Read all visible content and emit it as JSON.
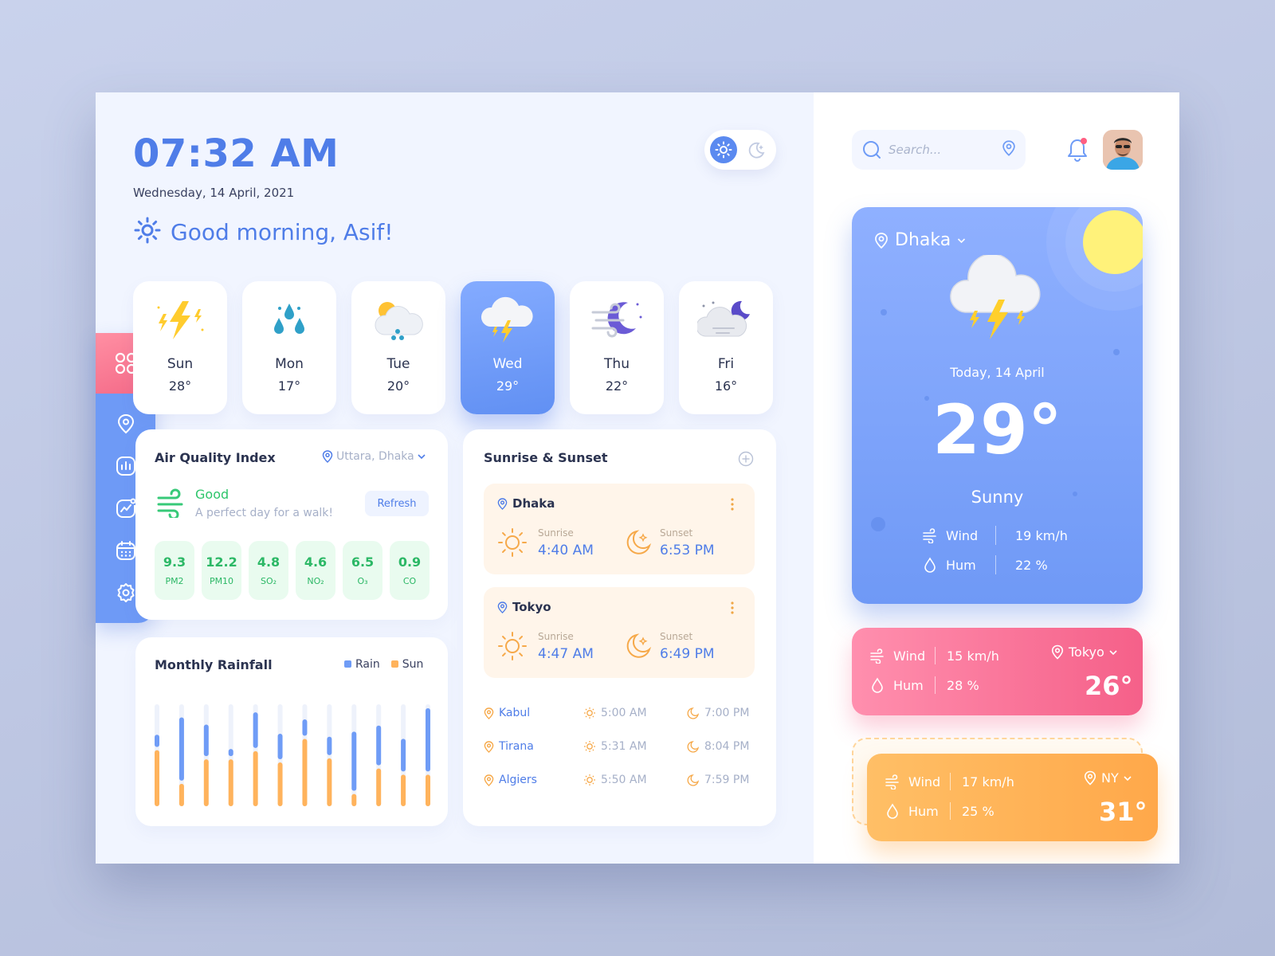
{
  "header": {
    "time": "07:32 AM",
    "date": "Wednesday, 14 April, 2021",
    "greeting": "Good morning, Asif!"
  },
  "theme_toggle": {
    "options": [
      "sun-icon",
      "moon-icon"
    ],
    "active": "sun-icon"
  },
  "sidebar": {
    "items": [
      "grid-icon",
      "location-icon",
      "chart-icon",
      "trend-icon",
      "calendar-icon",
      "settings-icon"
    ],
    "active": "grid-icon"
  },
  "forecast": [
    {
      "day": "Sun",
      "temp": "28°",
      "icon": "thunder-icon"
    },
    {
      "day": "Mon",
      "temp": "17°",
      "icon": "rain-drops-icon"
    },
    {
      "day": "Tue",
      "temp": "20°",
      "icon": "sun-cloud-rain-icon"
    },
    {
      "day": "Wed",
      "temp": "29°",
      "icon": "cloud-thunder-icon",
      "active": true
    },
    {
      "day": "Thu",
      "temp": "22°",
      "icon": "wind-moon-icon"
    },
    {
      "day": "Fri",
      "temp": "16°",
      "icon": "cloud-moon-icon"
    }
  ],
  "air_quality": {
    "title": "Air Quality Index",
    "location": "Uttara, Dhaka",
    "status": "Good",
    "message": "A perfect day for a walk!",
    "refresh_label": "Refresh",
    "metrics": [
      {
        "value": "9.3",
        "label": "PM2"
      },
      {
        "value": "12.2",
        "label": "PM10"
      },
      {
        "value": "4.8",
        "label": "SO₂"
      },
      {
        "value": "4.6",
        "label": "NO₂"
      },
      {
        "value": "6.5",
        "label": "O₃"
      },
      {
        "value": "0.9",
        "label": "CO"
      }
    ]
  },
  "rainfall": {
    "title": "Monthly Rainfall",
    "legend": {
      "rain": "Rain",
      "sun": "Sun"
    },
    "colors": {
      "rain": "#6f9cf6",
      "sun": "#ffb35c",
      "track": "#eef2fb"
    },
    "bars": [
      {
        "rain": 0.12,
        "sun": 0.55
      },
      {
        "rain": 0.62,
        "sun": 0.22
      },
      {
        "rain": 0.31,
        "sun": 0.46
      },
      {
        "rain": 0.07,
        "sun": 0.46
      },
      {
        "rain": 0.35,
        "sun": 0.54
      },
      {
        "rain": 0.25,
        "sun": 0.43
      },
      {
        "rain": 0.16,
        "sun": 0.66
      },
      {
        "rain": 0.18,
        "sun": 0.47
      },
      {
        "rain": 0.58,
        "sun": 0.12
      },
      {
        "rain": 0.39,
        "sun": 0.37
      },
      {
        "rain": 0.32,
        "sun": 0.31
      },
      {
        "rain": 0.62,
        "sun": 0.31
      }
    ]
  },
  "sun_times": {
    "title": "Sunrise & Sunset",
    "cards": [
      {
        "city": "Dhaka",
        "sunrise_label": "Sunrise",
        "sunrise": "4:40 AM",
        "sunset_label": "Sunset",
        "sunset": "6:53 PM"
      },
      {
        "city": "Tokyo",
        "sunrise_label": "Sunrise",
        "sunrise": "4:47 AM",
        "sunset_label": "Sunset",
        "sunset": "6:49 PM"
      }
    ],
    "rows": [
      {
        "city": "Kabul",
        "sunrise": "5:00 AM",
        "sunset": "7:00 PM"
      },
      {
        "city": "Tirana",
        "sunrise": "5:31 AM",
        "sunset": "8:04 PM"
      },
      {
        "city": "Algiers",
        "sunrise": "5:50 AM",
        "sunset": "7:59 PM"
      }
    ]
  },
  "search": {
    "placeholder": "Search..."
  },
  "current": {
    "city": "Dhaka",
    "date": "Today, 14 April",
    "temp": "29°",
    "condition": "Sunny",
    "wind_label": "Wind",
    "wind": "19 km/h",
    "hum_label": "Hum",
    "hum": "22 %"
  },
  "other_cities": [
    {
      "city": "Tokyo",
      "wind_label": "Wind",
      "wind": "15 km/h",
      "hum_label": "Hum",
      "hum": "28 %",
      "temp": "26°"
    },
    {
      "city": "NY",
      "wind_label": "Wind",
      "wind": "17 km/h",
      "hum_label": "Hum",
      "hum": "25 %",
      "temp": "31°"
    }
  ]
}
